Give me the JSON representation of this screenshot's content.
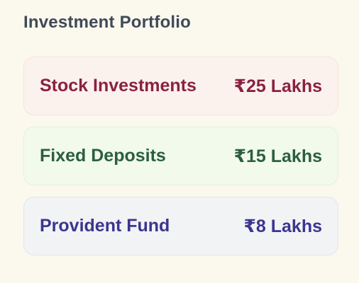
{
  "section": {
    "title": "Investment Portfolio"
  },
  "investments": [
    {
      "name": "Stock Investments",
      "amount": "₹25 Lakhs",
      "color": "#8a2142",
      "background": "#fcf2ed"
    },
    {
      "name": "Fixed Deposits",
      "amount": "₹15 Lakhs",
      "color": "#2b5f3f",
      "background": "#f1faeb"
    },
    {
      "name": "Provident Fund",
      "amount": "₹8 Lakhs",
      "color": "#3b3590",
      "background": "#f2f3f4"
    }
  ]
}
